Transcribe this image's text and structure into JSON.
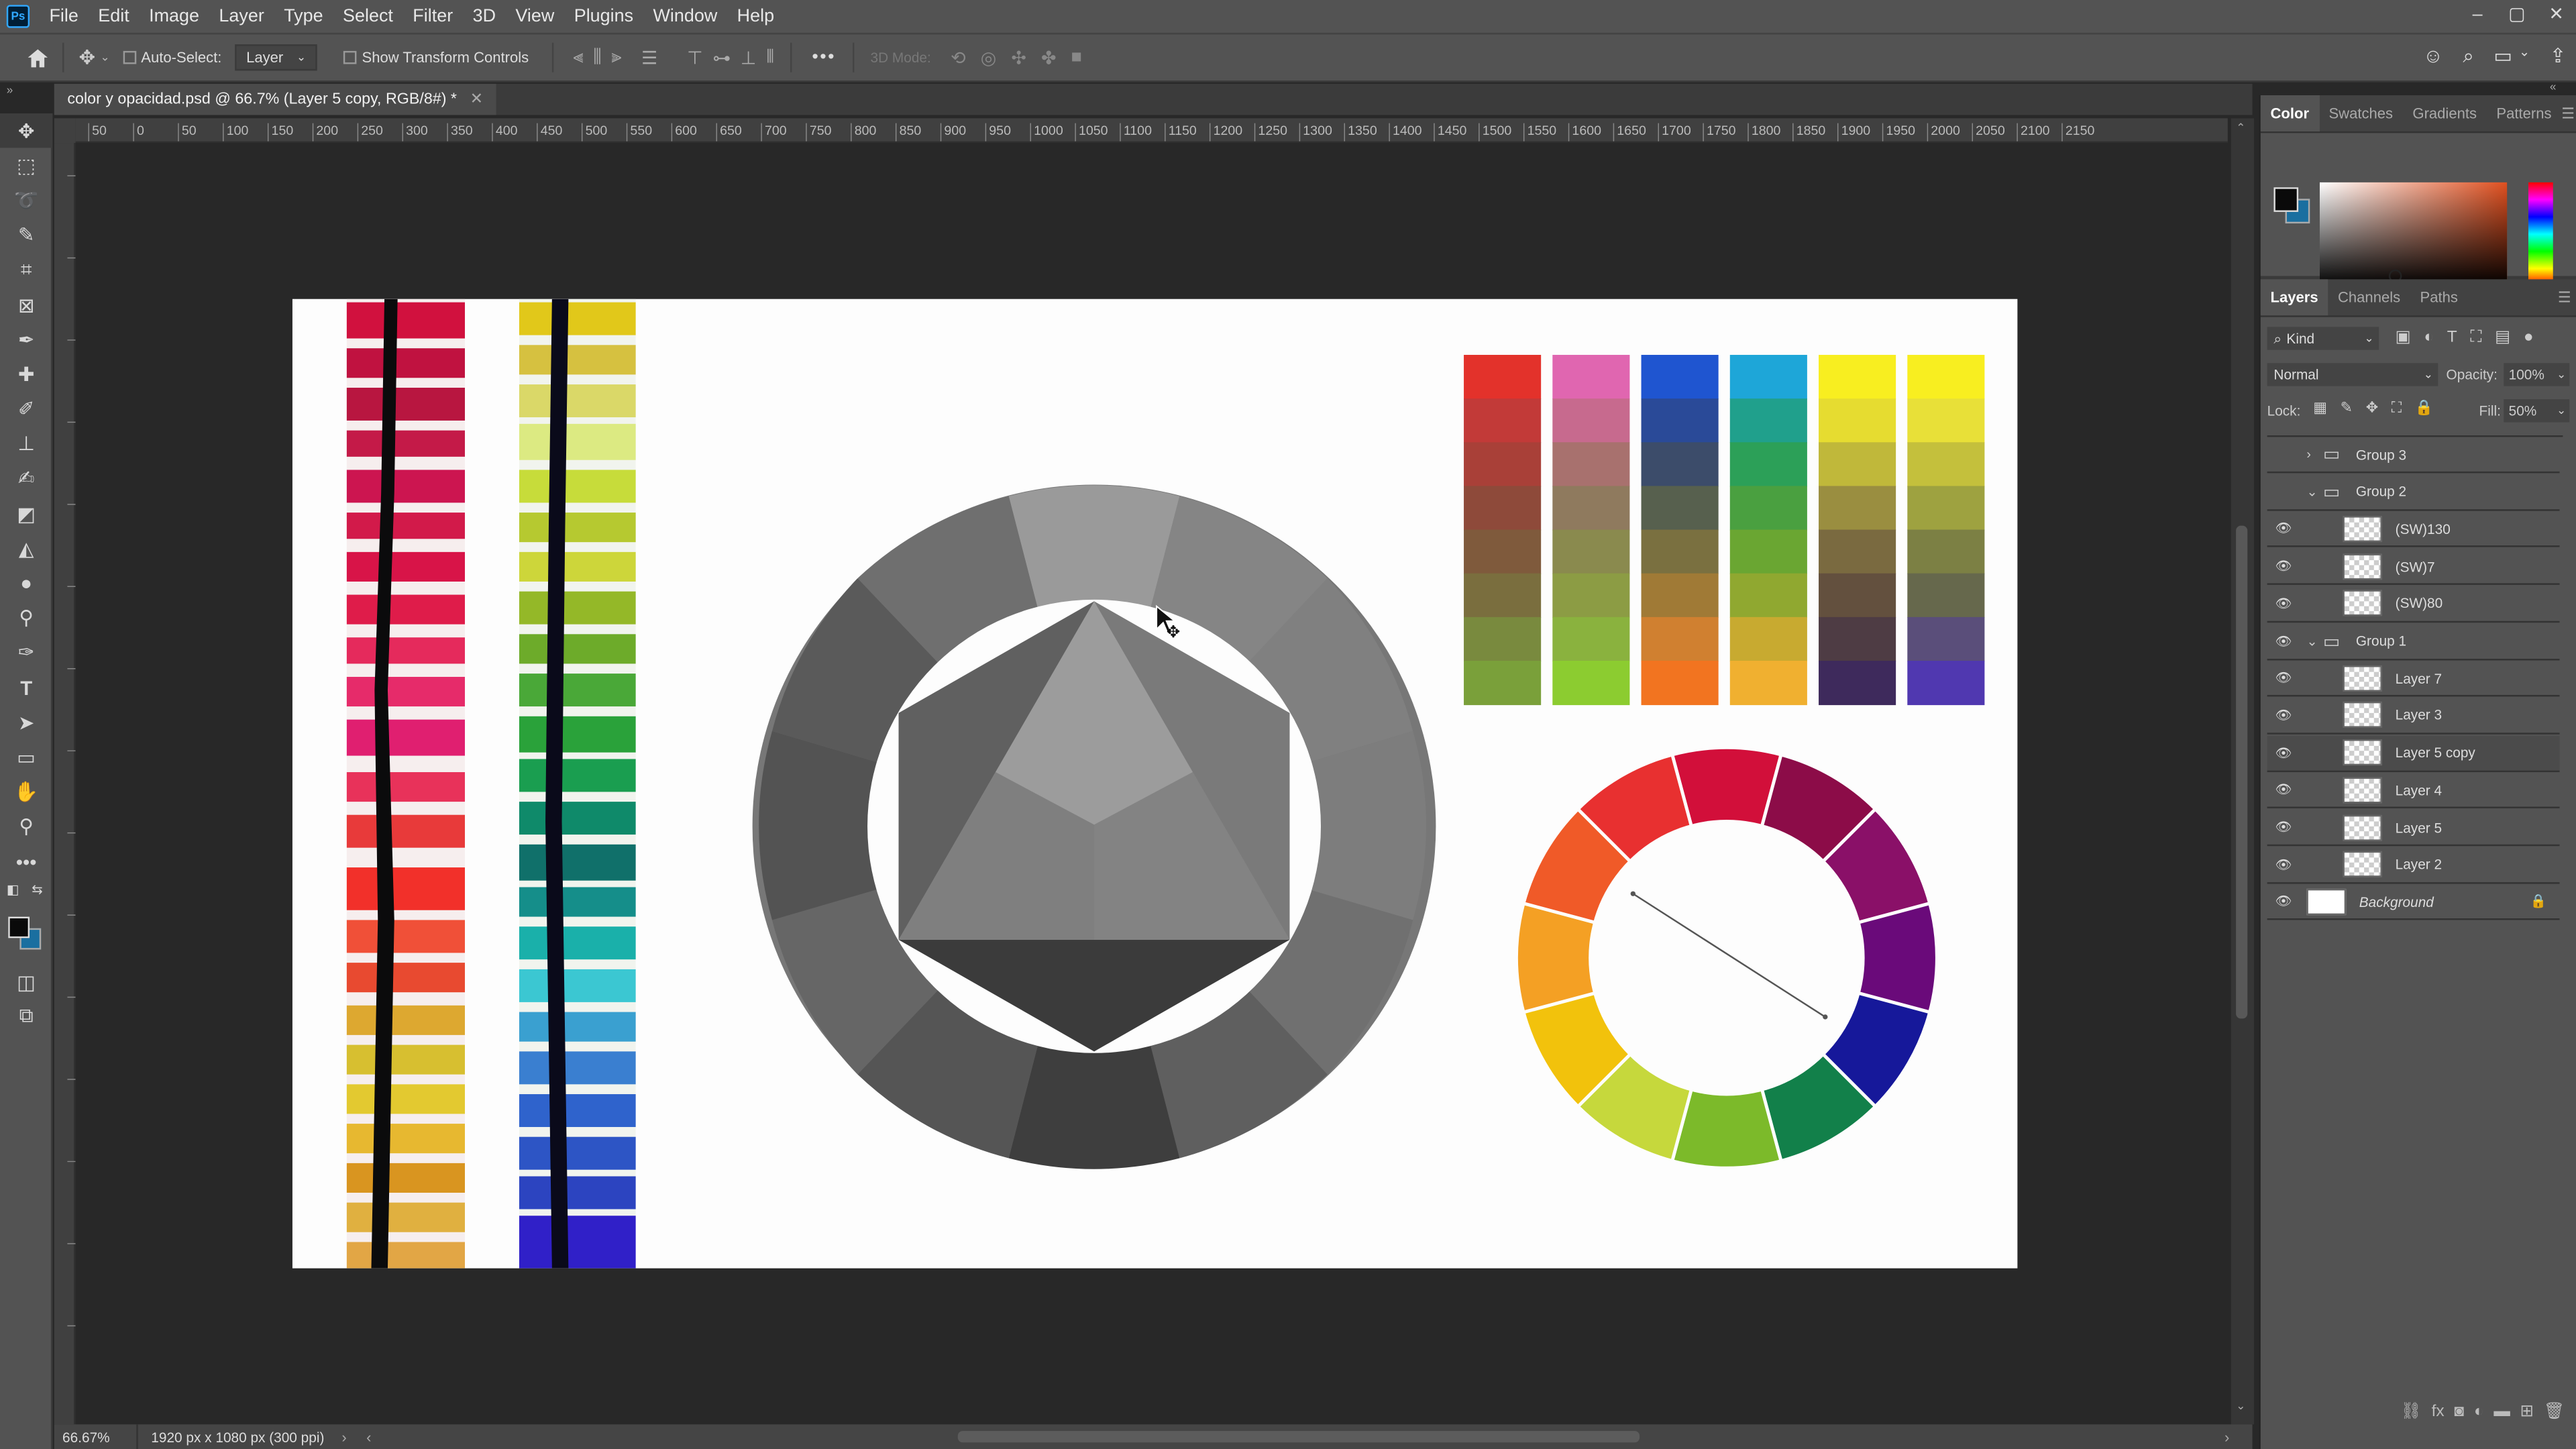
{
  "app": {
    "logo": "Ps"
  },
  "menu": [
    "File",
    "Edit",
    "Image",
    "Layer",
    "Type",
    "Select",
    "Filter",
    "3D",
    "View",
    "Plugins",
    "Window",
    "Help"
  ],
  "window_controls": [
    "–",
    "▢",
    "✕"
  ],
  "options_bar": {
    "auto_select_label": "Auto-Select:",
    "auto_select_target": "Layer",
    "show_transform_label": "Show Transform Controls",
    "three_d_mode_label": "3D Mode:",
    "more_label": "•••"
  },
  "document": {
    "tab_title": "color y opacidad.psd @ 66.7% (Layer 5 copy, RGB/8#) *",
    "zoom": "66.67%",
    "doc_info": "1920 px x 1080 px (300 ppi)"
  },
  "ruler_labels": [
    "50",
    "0",
    "50",
    "100",
    "150",
    "200",
    "250",
    "300",
    "350",
    "400",
    "450",
    "500",
    "550",
    "600",
    "650",
    "700",
    "750",
    "800",
    "850",
    "900",
    "950",
    "1000",
    "1050",
    "1100",
    "1150",
    "1200",
    "1250",
    "1300",
    "1350",
    "1400",
    "1450",
    "1500",
    "1550",
    "1600",
    "1650",
    "1700",
    "1750",
    "1800",
    "1850",
    "1900",
    "1950",
    "2000",
    "2050",
    "2100",
    "2150"
  ],
  "color_panel": {
    "tabs": [
      "Color",
      "Swatches",
      "Gradients",
      "Patterns"
    ],
    "active_tab": "Color",
    "foreground": "#0a0a0a",
    "background": "#1a6fa0"
  },
  "layers_panel": {
    "tabs": [
      "Layers",
      "Channels",
      "Paths"
    ],
    "active_tab": "Layers",
    "filter": "Kind",
    "blend_mode": "Normal",
    "opacity_label": "Opacity:",
    "opacity": "100%",
    "lock_label": "Lock:",
    "fill_label": "Fill:",
    "fill": "50%",
    "layers": [
      {
        "name": "Group 3",
        "type": "group",
        "visible": false,
        "indent": 0,
        "expanded": false
      },
      {
        "name": "Group 2",
        "type": "group",
        "visible": false,
        "indent": 0,
        "expanded": true
      },
      {
        "name": "(SW)130",
        "type": "layer",
        "visible": true,
        "indent": 1
      },
      {
        "name": "(SW)7",
        "type": "layer",
        "visible": true,
        "indent": 1
      },
      {
        "name": "(SW)80",
        "type": "layer",
        "visible": true,
        "indent": 1
      },
      {
        "name": "Group 1",
        "type": "group",
        "visible": true,
        "indent": 0,
        "expanded": true
      },
      {
        "name": "Layer 7",
        "type": "layer",
        "visible": true,
        "indent": 1
      },
      {
        "name": "Layer 3",
        "type": "layer",
        "visible": true,
        "indent": 1
      },
      {
        "name": "Layer 5 copy",
        "type": "layer",
        "visible": true,
        "indent": 1,
        "selected": true
      },
      {
        "name": "Layer 4",
        "type": "layer",
        "visible": true,
        "indent": 1
      },
      {
        "name": "Layer 5",
        "type": "layer",
        "visible": true,
        "indent": 1
      },
      {
        "name": "Layer 2",
        "type": "layer",
        "visible": true,
        "indent": 1
      },
      {
        "name": "Background",
        "type": "background",
        "visible": true,
        "indent": 0,
        "locked": true
      }
    ]
  },
  "icons": {
    "home": "home-icon",
    "move": "move-icon",
    "search": "search-icon",
    "share": "share-icon"
  }
}
